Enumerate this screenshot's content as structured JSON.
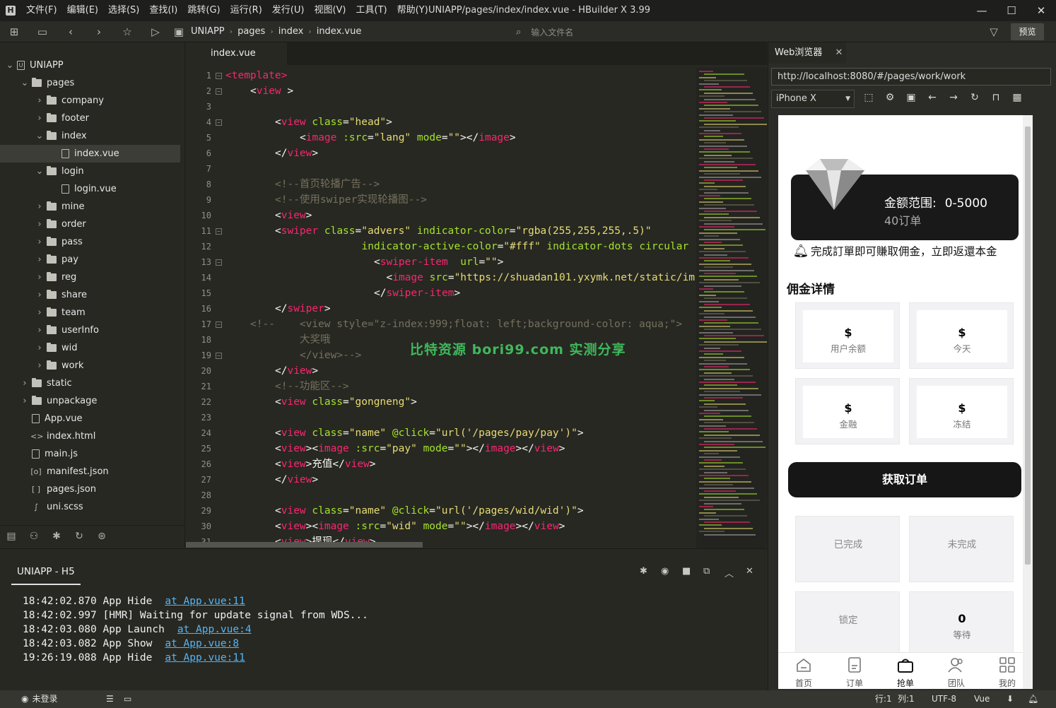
{
  "window": {
    "title": "UNIAPP/pages/index/index.vue - HBuilder X 3.99",
    "logo": "H"
  },
  "menu": [
    "文件(F)",
    "编辑(E)",
    "选择(S)",
    "查找(I)",
    "跳转(G)",
    "运行(R)",
    "发行(U)",
    "视图(V)",
    "工具(T)",
    "帮助(Y)"
  ],
  "toolbar": {
    "breadcrumb": [
      "UNIAPP",
      "pages",
      "index",
      "index.vue"
    ],
    "search_placeholder": "输入文件名",
    "preview_label": "预览"
  },
  "tree": [
    {
      "label": "UNIAPP",
      "type": "root",
      "level": 0,
      "expanded": true
    },
    {
      "label": "pages",
      "type": "folder",
      "level": 1,
      "expanded": true
    },
    {
      "label": "company",
      "type": "folder",
      "level": 2,
      "expanded": false
    },
    {
      "label": "footer",
      "type": "folder",
      "level": 2,
      "expanded": false
    },
    {
      "label": "index",
      "type": "folder",
      "level": 2,
      "expanded": true
    },
    {
      "label": "index.vue",
      "type": "file",
      "level": 3,
      "selected": true
    },
    {
      "label": "login",
      "type": "folder",
      "level": 2,
      "expanded": true
    },
    {
      "label": "login.vue",
      "type": "file",
      "level": 3
    },
    {
      "label": "mine",
      "type": "folder",
      "level": 2,
      "expanded": false
    },
    {
      "label": "order",
      "type": "folder",
      "level": 2,
      "expanded": false
    },
    {
      "label": "pass",
      "type": "folder",
      "level": 2,
      "expanded": false
    },
    {
      "label": "pay",
      "type": "folder",
      "level": 2,
      "expanded": false
    },
    {
      "label": "reg",
      "type": "folder",
      "level": 2,
      "expanded": false
    },
    {
      "label": "share",
      "type": "folder",
      "level": 2,
      "expanded": false
    },
    {
      "label": "team",
      "type": "folder",
      "level": 2,
      "expanded": false
    },
    {
      "label": "userInfo",
      "type": "folder",
      "level": 2,
      "expanded": false
    },
    {
      "label": "wid",
      "type": "folder",
      "level": 2,
      "expanded": false
    },
    {
      "label": "work",
      "type": "folder",
      "level": 2,
      "expanded": false
    },
    {
      "label": "static",
      "type": "folder",
      "level": 1,
      "expanded": false
    },
    {
      "label": "unpackage",
      "type": "folder",
      "level": 1,
      "expanded": false
    },
    {
      "label": "App.vue",
      "type": "file",
      "level": 1
    },
    {
      "label": "index.html",
      "type": "code",
      "level": 1,
      "glyph": "<>"
    },
    {
      "label": "main.js",
      "type": "file",
      "level": 1
    },
    {
      "label": "manifest.json",
      "type": "code",
      "level": 1,
      "glyph": "[o]"
    },
    {
      "label": "pages.json",
      "type": "code",
      "level": 1,
      "glyph": "[ ]"
    },
    {
      "label": "uni.scss",
      "type": "code",
      "level": 1,
      "glyph": "∫"
    }
  ],
  "editor": {
    "tab": "index.vue",
    "lines": [
      {
        "n": "1",
        "fold": true,
        "indent": 0,
        "t": [
          [
            "tag",
            "<template"
          ],
          [
            "tag",
            ">"
          ]
        ]
      },
      {
        "n": "2",
        "fold": true,
        "indent": 4,
        "t": [
          [
            "pun",
            "<"
          ],
          [
            "tag",
            "view"
          ],
          [
            "pun",
            " >"
          ]
        ]
      },
      {
        "n": "3",
        "indent": 0,
        "t": []
      },
      {
        "n": "4",
        "fold": true,
        "indent": 8,
        "t": [
          [
            "pun",
            "<"
          ],
          [
            "tag",
            "view"
          ],
          [
            "pun",
            " "
          ],
          [
            "att",
            "class"
          ],
          [
            "pun",
            "="
          ],
          [
            "str",
            "\"head\""
          ],
          [
            "pun",
            ">"
          ]
        ]
      },
      {
        "n": "5",
        "indent": 12,
        "t": [
          [
            "pun",
            "<"
          ],
          [
            "tag",
            "image"
          ],
          [
            "pun",
            " "
          ],
          [
            "att",
            ":src"
          ],
          [
            "pun",
            "="
          ],
          [
            "str",
            "\"lang\""
          ],
          [
            "pun",
            " "
          ],
          [
            "att",
            "mode"
          ],
          [
            "pun",
            "="
          ],
          [
            "str",
            "\"\""
          ],
          [
            "pun",
            "></"
          ],
          [
            "tag",
            "image"
          ],
          [
            "pun",
            ">"
          ]
        ]
      },
      {
        "n": "6",
        "indent": 8,
        "t": [
          [
            "pun",
            "</"
          ],
          [
            "tag",
            "view"
          ],
          [
            "pun",
            ">"
          ]
        ]
      },
      {
        "n": "7",
        "indent": 0,
        "t": []
      },
      {
        "n": "8",
        "indent": 8,
        "t": [
          [
            "cmt",
            "<!--首页轮播广告-->"
          ]
        ]
      },
      {
        "n": "9",
        "indent": 8,
        "t": [
          [
            "cmt",
            "<!--使用swiper实现轮播图-->"
          ]
        ]
      },
      {
        "n": "10",
        "indent": 8,
        "t": [
          [
            "pun",
            "<"
          ],
          [
            "tag",
            "view"
          ],
          [
            "pun",
            ">"
          ]
        ]
      },
      {
        "n": "11",
        "fold": true,
        "indent": 8,
        "t": [
          [
            "pun",
            "<"
          ],
          [
            "tag",
            "swiper"
          ],
          [
            "pun",
            " "
          ],
          [
            "att",
            "class"
          ],
          [
            "pun",
            "="
          ],
          [
            "str",
            "\"advers\""
          ],
          [
            "pun",
            " "
          ],
          [
            "att",
            "indicator-color"
          ],
          [
            "pun",
            "="
          ],
          [
            "str",
            "\"rgba(255,255,255,.5)\""
          ]
        ]
      },
      {
        "n": "12",
        "indent": 22,
        "t": [
          [
            "att",
            "indicator-active-color"
          ],
          [
            "pun",
            "="
          ],
          [
            "str",
            "\"#fff\""
          ],
          [
            "pun",
            " "
          ],
          [
            "att",
            "indicator-dots circular"
          ]
        ]
      },
      {
        "n": "13",
        "fold": true,
        "indent": 24,
        "t": [
          [
            "pun",
            "<"
          ],
          [
            "tag",
            "swiper-item"
          ],
          [
            "pun",
            "  "
          ],
          [
            "att",
            "url"
          ],
          [
            "pun",
            "="
          ],
          [
            "str",
            "\"\""
          ],
          [
            "pun",
            ">"
          ]
        ]
      },
      {
        "n": "14",
        "indent": 26,
        "t": [
          [
            "pun",
            "<"
          ],
          [
            "tag",
            "image"
          ],
          [
            "pun",
            " "
          ],
          [
            "att",
            "src"
          ],
          [
            "pun",
            "="
          ],
          [
            "str",
            "\"https://shuadan101.yxymk.net/static/im"
          ]
        ]
      },
      {
        "n": "15",
        "indent": 24,
        "t": [
          [
            "pun",
            "</"
          ],
          [
            "tag",
            "swiper-item"
          ],
          [
            "pun",
            ">"
          ]
        ]
      },
      {
        "n": "16",
        "indent": 8,
        "t": [
          [
            "pun",
            "</"
          ],
          [
            "tag",
            "swiper"
          ],
          [
            "pun",
            ">"
          ]
        ]
      },
      {
        "n": "17",
        "fold": true,
        "indent": 4,
        "t": [
          [
            "cmt",
            "<!--    <view style=\"z-index:999;float: left;background-color: aqua;\">"
          ]
        ]
      },
      {
        "n": "18",
        "indent": 12,
        "t": [
          [
            "cmt",
            "大奖哦"
          ]
        ]
      },
      {
        "n": "19",
        "fold": true,
        "indent": 12,
        "t": [
          [
            "cmt",
            "</view>-->"
          ]
        ]
      },
      {
        "n": "20",
        "indent": 8,
        "t": [
          [
            "pun",
            "</"
          ],
          [
            "tag",
            "view"
          ],
          [
            "pun",
            ">"
          ]
        ]
      },
      {
        "n": "21",
        "indent": 8,
        "t": [
          [
            "cmt",
            "<!--功能区-->"
          ]
        ]
      },
      {
        "n": "22",
        "indent": 8,
        "t": [
          [
            "pun",
            "<"
          ],
          [
            "tag",
            "view"
          ],
          [
            "pun",
            " "
          ],
          [
            "att",
            "class"
          ],
          [
            "pun",
            "="
          ],
          [
            "str",
            "\"gongneng\""
          ],
          [
            "pun",
            ">"
          ]
        ]
      },
      {
        "n": "23",
        "indent": 0,
        "t": []
      },
      {
        "n": "24",
        "indent": 8,
        "t": [
          [
            "pun",
            "<"
          ],
          [
            "tag",
            "view"
          ],
          [
            "pun",
            " "
          ],
          [
            "att",
            "class"
          ],
          [
            "pun",
            "="
          ],
          [
            "str",
            "\"name\""
          ],
          [
            "pun",
            " "
          ],
          [
            "att",
            "@click"
          ],
          [
            "pun",
            "="
          ],
          [
            "str",
            "\"url('/pages/pay/pay')\""
          ],
          [
            "pun",
            ">"
          ]
        ]
      },
      {
        "n": "25",
        "indent": 8,
        "t": [
          [
            "pun",
            "<"
          ],
          [
            "tag",
            "view"
          ],
          [
            "pun",
            "><"
          ],
          [
            "tag",
            "image"
          ],
          [
            "pun",
            " "
          ],
          [
            "att",
            ":src"
          ],
          [
            "pun",
            "="
          ],
          [
            "str",
            "\"pay\""
          ],
          [
            "pun",
            " "
          ],
          [
            "att",
            "mode"
          ],
          [
            "pun",
            "="
          ],
          [
            "str",
            "\"\""
          ],
          [
            "pun",
            "></"
          ],
          [
            "tag",
            "image"
          ],
          [
            "pun",
            "></"
          ],
          [
            "tag",
            "view"
          ],
          [
            "pun",
            ">"
          ]
        ]
      },
      {
        "n": "26",
        "indent": 8,
        "t": [
          [
            "pun",
            "<"
          ],
          [
            "tag",
            "view"
          ],
          [
            "pun",
            ">"
          ],
          [
            "txt",
            "充值"
          ],
          [
            "pun",
            "</"
          ],
          [
            "tag",
            "view"
          ],
          [
            "pun",
            ">"
          ]
        ]
      },
      {
        "n": "27",
        "indent": 8,
        "t": [
          [
            "pun",
            "</"
          ],
          [
            "tag",
            "view"
          ],
          [
            "pun",
            ">"
          ]
        ]
      },
      {
        "n": "28",
        "indent": 0,
        "t": []
      },
      {
        "n": "29",
        "indent": 8,
        "t": [
          [
            "pun",
            "<"
          ],
          [
            "tag",
            "view"
          ],
          [
            "pun",
            " "
          ],
          [
            "att",
            "class"
          ],
          [
            "pun",
            "="
          ],
          [
            "str",
            "\"name\""
          ],
          [
            "pun",
            " "
          ],
          [
            "att",
            "@click"
          ],
          [
            "pun",
            "="
          ],
          [
            "str",
            "\"url('/pages/wid/wid')\""
          ],
          [
            "pun",
            ">"
          ]
        ]
      },
      {
        "n": "30",
        "indent": 8,
        "t": [
          [
            "pun",
            "<"
          ],
          [
            "tag",
            "view"
          ],
          [
            "pun",
            "><"
          ],
          [
            "tag",
            "image"
          ],
          [
            "pun",
            " "
          ],
          [
            "att",
            ":src"
          ],
          [
            "pun",
            "="
          ],
          [
            "str",
            "\"wid\""
          ],
          [
            "pun",
            " "
          ],
          [
            "att",
            "mode"
          ],
          [
            "pun",
            "="
          ],
          [
            "str",
            "\"\""
          ],
          [
            "pun",
            "></"
          ],
          [
            "tag",
            "image"
          ],
          [
            "pun",
            "></"
          ],
          [
            "tag",
            "view"
          ],
          [
            "pun",
            ">"
          ]
        ]
      },
      {
        "n": "31",
        "indent": 8,
        "t": [
          [
            "pun",
            "<"
          ],
          [
            "tag",
            "view"
          ],
          [
            "pun",
            ">"
          ],
          [
            "txt",
            "提现"
          ],
          [
            "pun",
            "</"
          ],
          [
            "tag",
            "view"
          ],
          [
            "pun",
            ">"
          ]
        ]
      }
    ]
  },
  "watermark": "比特资源 bori99.com 实测分享",
  "console": {
    "tab": "UNIAPP - H5",
    "logs": [
      {
        "time": "18:42:02.870",
        "msg": "App Hide",
        "link": "at App.vue:11"
      },
      {
        "time": "18:42:02.997",
        "msg": "[HMR] Waiting for update signal from WDS...",
        "link": ""
      },
      {
        "time": "18:42:03.080",
        "msg": "App Launch",
        "link": "at App.vue:4"
      },
      {
        "time": "18:42:03.082",
        "msg": "App Show",
        "link": "at App.vue:8"
      },
      {
        "time": "19:26:19.088",
        "msg": "App Hide",
        "link": "at App.vue:11"
      }
    ]
  },
  "statusbar": {
    "login": "未登录",
    "position": "行:1",
    "column": "列:1",
    "encoding": "UTF-8",
    "language": "Vue"
  },
  "browser": {
    "tab": "Web浏览器",
    "url": "http://localhost:8080/#/pages/work/work",
    "device": "iPhone X",
    "app": {
      "range_label": "金额范围:",
      "range_value": "0-5000",
      "orders": "40订单",
      "notice": "完成訂單即可賺取佣金，立即返還本金",
      "section_title": "佣金详情",
      "stats": [
        {
          "value": "$",
          "label": "用户余额"
        },
        {
          "value": "$",
          "label": "今天"
        },
        {
          "value": "$",
          "label": "金融"
        },
        {
          "value": "$",
          "label": "冻结"
        }
      ],
      "get_order": "获取订单",
      "status_cards": [
        {
          "label": "已完成",
          "value": ""
        },
        {
          "label": "未完成",
          "value": ""
        },
        {
          "label": "锁定",
          "value": ""
        },
        {
          "label": "等待",
          "value": "0"
        }
      ],
      "nav": [
        "首页",
        "订单",
        "抢单",
        "团队",
        "我的"
      ]
    }
  }
}
